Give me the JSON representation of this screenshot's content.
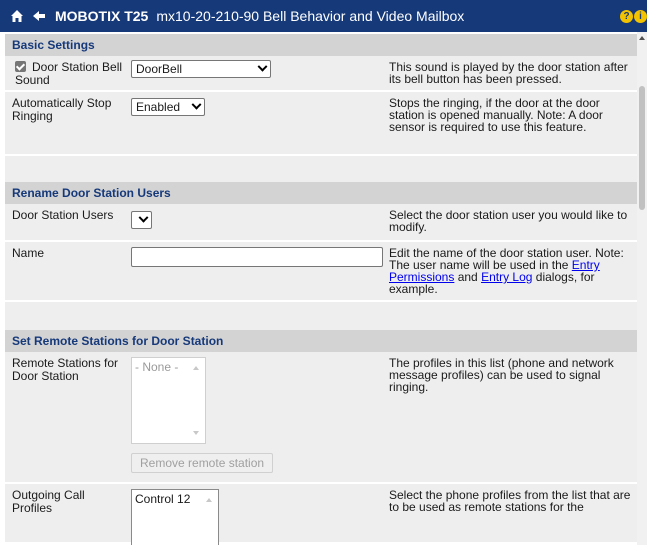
{
  "titlebar": {
    "brand": "MOBOTIX T25",
    "subtitle": "mx10-20-210-90 Bell Behavior and Video Mailbox",
    "help_glyph": "?",
    "info_glyph": "i"
  },
  "sections": {
    "basic": {
      "title": "Basic Settings",
      "door_bell": {
        "label": "Door Station Bell Sound",
        "checked": true,
        "value": "DoorBell",
        "desc": "This sound is played by the door station after its bell button has been pressed."
      },
      "auto_stop": {
        "label": "Automatically Stop Ringing",
        "value": "Enabled",
        "desc": "Stops the ringing, if the door at the door station is opened manually. Note: A door sensor is required to use this feature."
      }
    },
    "rename": {
      "title": "Rename Door Station Users",
      "users": {
        "label": "Door Station Users",
        "value": "",
        "desc": "Select the door station user you would like to modify."
      },
      "name": {
        "label": "Name",
        "value": "",
        "desc_prefix": "Edit the name of the door station user. Note: The user name will be used in the",
        "link1": "Entry Permissions",
        "and": "and",
        "link2": "Entry Log",
        "desc_suffix": "dialogs, for example."
      }
    },
    "remote": {
      "title": "Set Remote Stations for Door Station",
      "stations": {
        "label": "Remote Stations for Door Station",
        "list_item": "- None -",
        "remove_button": "Remove remote station",
        "desc": "The profiles in this list (phone and network message profiles) can be used to signal ringing."
      },
      "outgoing": {
        "label": "Outgoing Call Profiles",
        "list_item": "Control 12",
        "desc": "Select the phone profiles from the list that are to be used as remote stations for the"
      }
    }
  },
  "colors": {
    "titlebar_bg": "#16397a",
    "section_bg": "#d3d3d3",
    "row_bg": "#eeeeee",
    "link": "#0000ee",
    "icon_yellow": "#f3c300"
  },
  "icons": [
    "home-icon",
    "back-arrow-icon",
    "help-icon",
    "info-icon",
    "checkbox-checked-icon",
    "chevron-down-icon"
  ]
}
